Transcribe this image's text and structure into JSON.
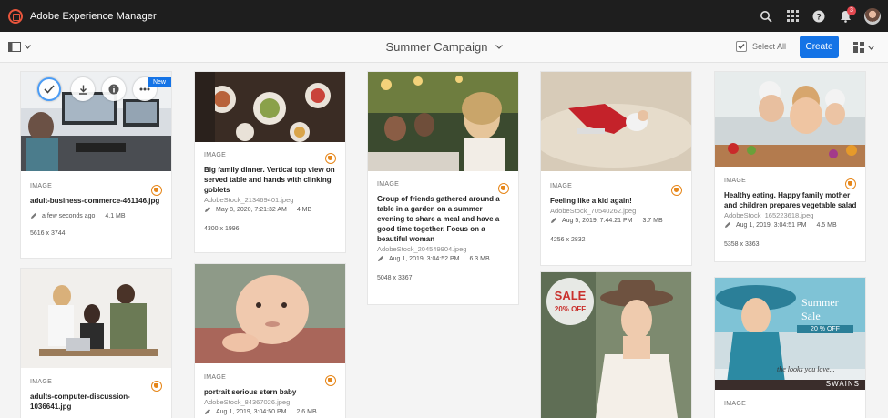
{
  "shell": {
    "app_title": "Adobe Experience Manager",
    "notification_count": "3"
  },
  "actionbar": {
    "title": "Summer Campaign",
    "select_all": "Select All",
    "create": "Create"
  },
  "cards": [
    {
      "type": "IMAGE",
      "title": "adult-business-commerce-461146.jpg",
      "subtitle": "",
      "modified": "a few seconds ago",
      "size": "4.1 MB",
      "dimensions": "5616 x 3744",
      "badge": "New"
    },
    {
      "type": "IMAGE",
      "title": "Big family dinner. Vertical top view on served table and hands with clinking goblets",
      "subtitle": "AdobeStock_213469401.jpeg",
      "modified": "May 8, 2020, 7:21:32 AM",
      "size": "4 MB",
      "dimensions": "4300 x 1996"
    },
    {
      "type": "IMAGE",
      "title": "Group of friends gathered around a table in a garden on a summer evening to share a meal and have a good time together. Focus on a beautiful woman",
      "subtitle": "AdobeStock_204549904.jpeg",
      "modified": "Aug 1, 2019, 3:04:52 PM",
      "size": "6.3 MB",
      "dimensions": "5048 x 3367"
    },
    {
      "type": "IMAGE",
      "title": "Feeling like a kid again!",
      "subtitle": "AdobeStock_70540262.jpeg",
      "modified": "Aug 5, 2019, 7:44:21 PM",
      "size": "3.7 MB",
      "dimensions": "4256 x 2832"
    },
    {
      "type": "IMAGE",
      "title": "Healthy eating. Happy family mother and children prepares vegetable salad",
      "subtitle": "AdobeStock_165223618.jpeg",
      "modified": "Aug 1, 2019, 3:04:51 PM",
      "size": "4.5 MB",
      "dimensions": "5358 x 3363"
    },
    {
      "type": "IMAGE",
      "title": "adults-computer-discussion-1036641.jpg"
    },
    {
      "type": "IMAGE",
      "title": "portrait serious stern baby",
      "subtitle": "AdobeStock_84367026.jpeg",
      "modified": "Aug 1, 2019, 3:04:50 PM",
      "size": "2.6 MB"
    },
    {
      "type": "",
      "sale_text": "SALE",
      "sale_sub": "20% OFF"
    },
    {
      "type": "IMAGE",
      "ad_title": "Summer",
      "ad_title2": "Sale",
      "ad_offer": "20 % OFF",
      "ad_tagline": "the looks you love...",
      "ad_brand": "SWAINS"
    }
  ]
}
